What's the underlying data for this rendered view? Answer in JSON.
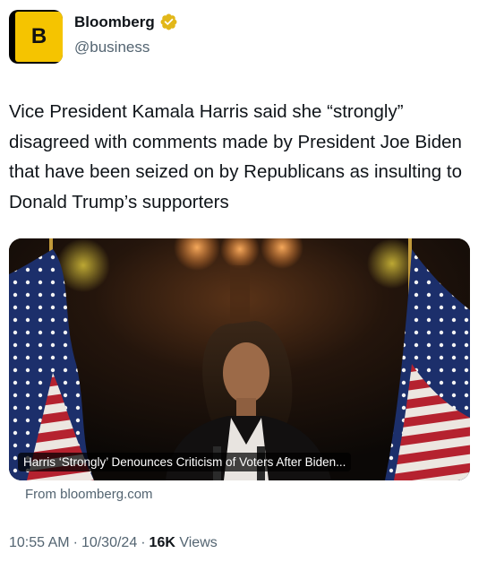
{
  "author": {
    "avatar_letter": "B",
    "display_name": "Bloomberg",
    "handle": "@business",
    "verified_badge_color": "#e2b719",
    "verified_icon": "verified-badge-icon"
  },
  "tweet": {
    "text": "Vice President Kamala Harris said she “strongly” disagreed with comments made by President Joe Biden that have been seized on by Republicans as insulting to Donald Trump’s supporters"
  },
  "link_card": {
    "caption": "Harris ‘Strongly’ Denounces Criticism of Voters After Biden...",
    "source": "From bloomberg.com"
  },
  "meta": {
    "time": "10:55 AM",
    "separator": "·",
    "date": "10/30/24",
    "views_count": "16K",
    "views_label": "Views"
  },
  "colors": {
    "text_primary": "#0f1419",
    "text_secondary": "#536471",
    "avatar_yellow": "#f5c400"
  }
}
